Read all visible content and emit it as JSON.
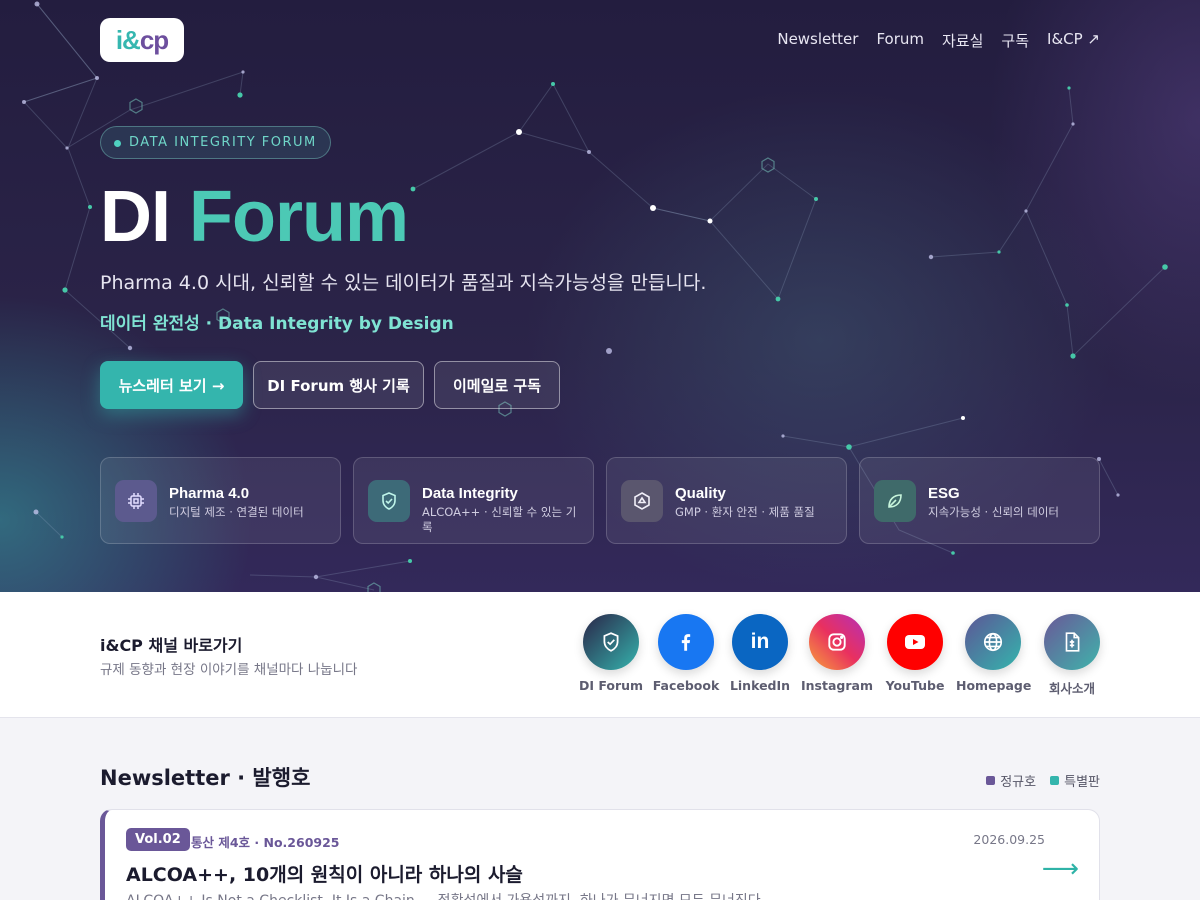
{
  "header": {
    "logo_text_a": "i&",
    "logo_text_b": "cp",
    "nav": [
      {
        "label": "Newsletter"
      },
      {
        "label": "Forum"
      },
      {
        "label": "자료실"
      },
      {
        "label": "구독"
      },
      {
        "label": "I&CP ↗"
      }
    ]
  },
  "hero": {
    "badge": "DATA INTEGRITY FORUM",
    "title_part1": "DI",
    "title_part2": "Forum",
    "subtitle": "Pharma 4.0 시대, 신뢰할 수 있는 데이터가 품질과 지속가능성을 만듭니다.",
    "tagline": "데이터 완전성 · Data Integrity by Design",
    "buttons": {
      "primary": "뉴스레터 보기 →",
      "secondary1": "DI Forum 행사 기록",
      "secondary2": "이메일로 구독"
    },
    "cards": [
      {
        "title": "Pharma 4.0",
        "subtitle": "디지털 제조 · 연결된 데이터",
        "icon": "chip-icon",
        "color": "#5c5a8e"
      },
      {
        "title": "Data Integrity",
        "subtitle": "ALCOA++ · 신뢰할 수 있는 기록",
        "icon": "shield-check-icon",
        "color": "#3d6a78"
      },
      {
        "title": "Quality",
        "subtitle": "GMP · 환자 안전 · 제품 품질",
        "icon": "hexagon-icon",
        "color": "#5a566e"
      },
      {
        "title": "ESG",
        "subtitle": "지속가능성 · 신뢰의 데이터",
        "icon": "leaf-icon",
        "color": "#3f6a6a"
      }
    ]
  },
  "channels": {
    "title": "i&CP 채널 바로가기",
    "subtitle": "규제 동향과 현장 이야기를 채널마다 나눕니다",
    "items": [
      {
        "label": "DI Forum",
        "icon": "shield-icon"
      },
      {
        "label": "Facebook",
        "icon": "facebook-icon",
        "color": "#1877f2"
      },
      {
        "label": "LinkedIn",
        "icon": "linkedin-icon",
        "color": "#0a66c2"
      },
      {
        "label": "Instagram",
        "icon": "instagram-icon"
      },
      {
        "label": "YouTube",
        "icon": "youtube-icon",
        "color": "#ff0000"
      },
      {
        "label": "Homepage",
        "icon": "globe-icon"
      },
      {
        "label": "회사소개",
        "icon": "document-icon"
      }
    ]
  },
  "newsletter": {
    "heading": "Newsletter · 발행호",
    "legend": [
      {
        "label": "정규호",
        "color": "#6a5798"
      },
      {
        "label": "특별판",
        "color": "#34b5ad"
      }
    ],
    "issue": {
      "vol": "Vol.02",
      "number": "통산 제4호 · No.260925",
      "date": "2026.09.25",
      "title": "ALCOA++, 10개의 원칙이 아니라 하나의 사슬",
      "subtitle": "ALCOA++ Is Not a Checklist, It Is a Chain — 정확성에서 가용성까지, 하나가 무너지면 모두 무너진다"
    }
  },
  "colors": {
    "accent_teal": "#34b5ad",
    "accent_purple": "#6a5798",
    "hero_bg": "#2b2449"
  }
}
